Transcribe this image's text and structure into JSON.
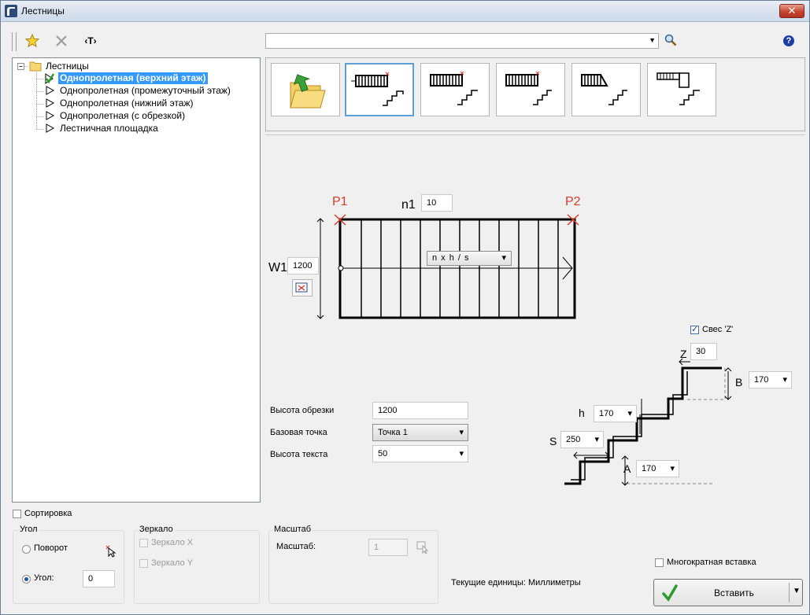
{
  "window": {
    "title": "Лестницы"
  },
  "toolbar": {
    "close_glyph": "✕",
    "text_tool": "‹T›"
  },
  "search": {
    "value": ""
  },
  "tree": {
    "root": "Лестницы",
    "items": [
      {
        "label": "Однопролетная (верхний этаж)",
        "selected": true
      },
      {
        "label": "Однопролетная (промежуточный этаж)"
      },
      {
        "label": "Однопролетная (нижний этаж)"
      },
      {
        "label": "Однопролетная (с обрезкой)"
      },
      {
        "label": "Лестничная площадка"
      }
    ]
  },
  "drawing": {
    "p1": "P1",
    "p2": "P2",
    "n1_label": "n1",
    "n1_value": "10",
    "w1_label": "W1",
    "w1_value": "1200",
    "formula": "n x h / s",
    "z_label": "Z",
    "z_value": "30",
    "b_label": "B",
    "b_value": "170",
    "h_label": "h",
    "h_value": "170",
    "s_label": "S",
    "s_value": "250",
    "a_label": "A",
    "a_value": "170",
    "svez_label": "Свес  'Z'",
    "svez_checked": true
  },
  "props": {
    "cut_height_label": "Высота обрезки",
    "cut_height_value": "1200",
    "base_point_label": "Базовая точка",
    "base_point_value": "Точка 1",
    "text_height_label": "Высота текста",
    "text_height_value": "50"
  },
  "bottom": {
    "sort_label": "Сортировка",
    "angle_group": "Угол",
    "rotation_label": "Поворот",
    "angle_label": "Угол:",
    "angle_value": "0",
    "mirror_group": "Зеркало",
    "mirror_x": "Зеркало X",
    "mirror_y": "Зеркало Y",
    "scale_group": "Масштаб",
    "scale_label": "Масштаб:",
    "scale_value": "1",
    "units_text": "Текущие единицы: Миллиметры",
    "multi_insert": "Многократная вставка",
    "insert_button": "Вставить"
  },
  "colors": {
    "selection": "#3399ff",
    "point_marker": "#d93b2b",
    "accent_blue": "#1c55b0"
  }
}
